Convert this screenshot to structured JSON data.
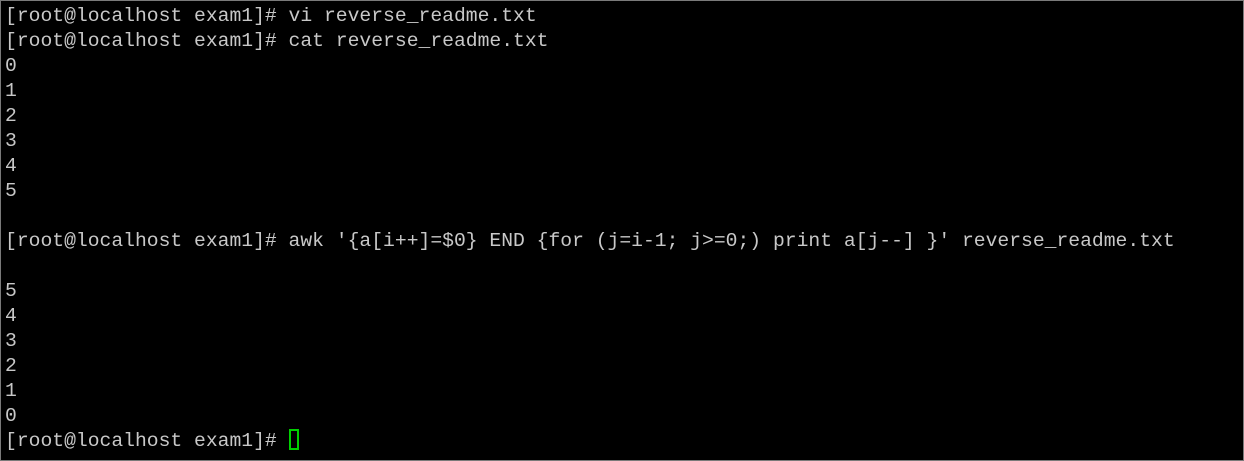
{
  "terminal": {
    "lines": [
      "[root@localhost exam1]# vi reverse_readme.txt",
      "[root@localhost exam1]# cat reverse_readme.txt",
      "0",
      "1",
      "2",
      "3",
      "4",
      "5",
      "",
      "[root@localhost exam1]# awk '{a[i++]=$0} END {for (j=i-1; j>=0;) print a[j--] }' reverse_readme.txt",
      "",
      "5",
      "4",
      "3",
      "2",
      "1",
      "0"
    ],
    "prompt": "[root@localhost exam1]# ",
    "cursor_color": "#00d000",
    "text_color": "#c8c8c8",
    "background_color": "#000000"
  }
}
